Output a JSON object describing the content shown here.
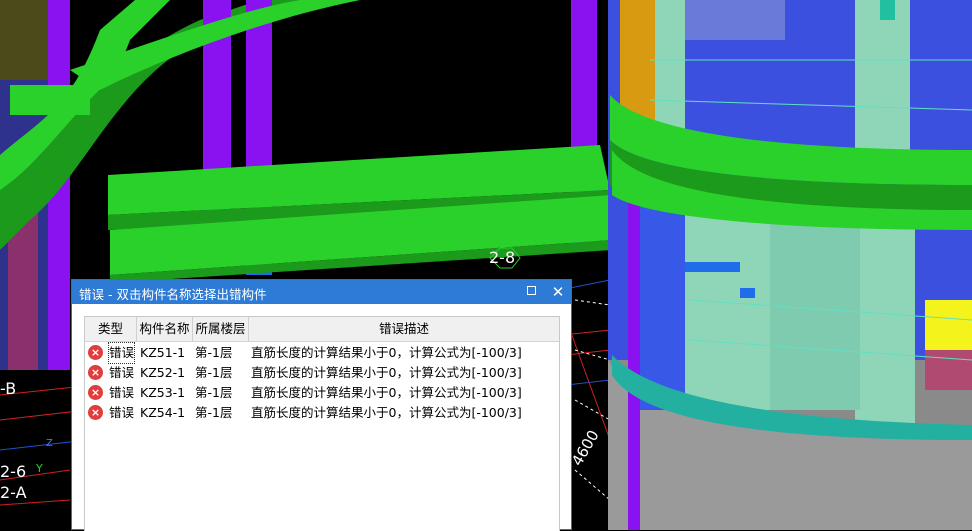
{
  "viewport": {
    "labels": {
      "axis_2_8": "2-8",
      "axis_b": "-B",
      "axis_2_6": "2-6",
      "axis_2_a": "2-A",
      "dim_4600": "4600",
      "axis_z": "Z",
      "axis_y": "Y"
    }
  },
  "dialog": {
    "title": "错误 - 双击构件名称选择出错构件",
    "columns": [
      "类型",
      "构件名称",
      "所属楼层",
      "错误描述"
    ],
    "rows": [
      {
        "type": "错误",
        "name": "KZ51-1",
        "floor": "第-1层",
        "desc": "直筋长度的计算结果小于0，计算公式为[-100/3]"
      },
      {
        "type": "错误",
        "name": "KZ52-1",
        "floor": "第-1层",
        "desc": "直筋长度的计算结果小于0，计算公式为[-100/3]"
      },
      {
        "type": "错误",
        "name": "KZ53-1",
        "floor": "第-1层",
        "desc": "直筋长度的计算结果小于0，计算公式为[-100/3]"
      },
      {
        "type": "错误",
        "name": "KZ54-1",
        "floor": "第-1层",
        "desc": "直筋长度的计算结果小于0，计算公式为[-100/3]"
      }
    ]
  },
  "colors": {
    "beam_green": "#2bd12b",
    "column_purple": "#8a12f0",
    "column_blue": "#1f6de8",
    "wall_teal": "#8fd6b8",
    "slab_blue": "#3c50e0",
    "titlebar": "#2e7bd6",
    "error_red": "#e23c3c"
  },
  "icons": {
    "error": "error-circle-icon",
    "maximize": "maximize-icon",
    "close": "close-icon"
  }
}
